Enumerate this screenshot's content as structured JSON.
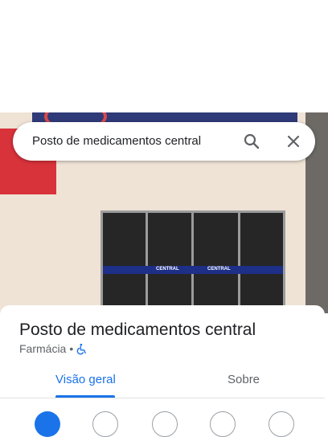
{
  "search": {
    "query": "Posto de medicamentos central",
    "search_icon": "search-icon",
    "close_icon": "close-icon"
  },
  "photo": {
    "window_band_text": [
      "CENTRAL",
      "CENTRAL"
    ]
  },
  "place": {
    "name": "Posto de medicamentos central",
    "category": "Farmácia",
    "separator": "•",
    "accessibility_icon": "wheelchair-icon"
  },
  "tabs": [
    {
      "label": "Visão geral",
      "selected": true
    },
    {
      "label": "Sobre",
      "selected": false
    }
  ],
  "colors": {
    "accent": "#1a73e8",
    "text_primary": "#202124",
    "text_secondary": "#5f6368"
  }
}
